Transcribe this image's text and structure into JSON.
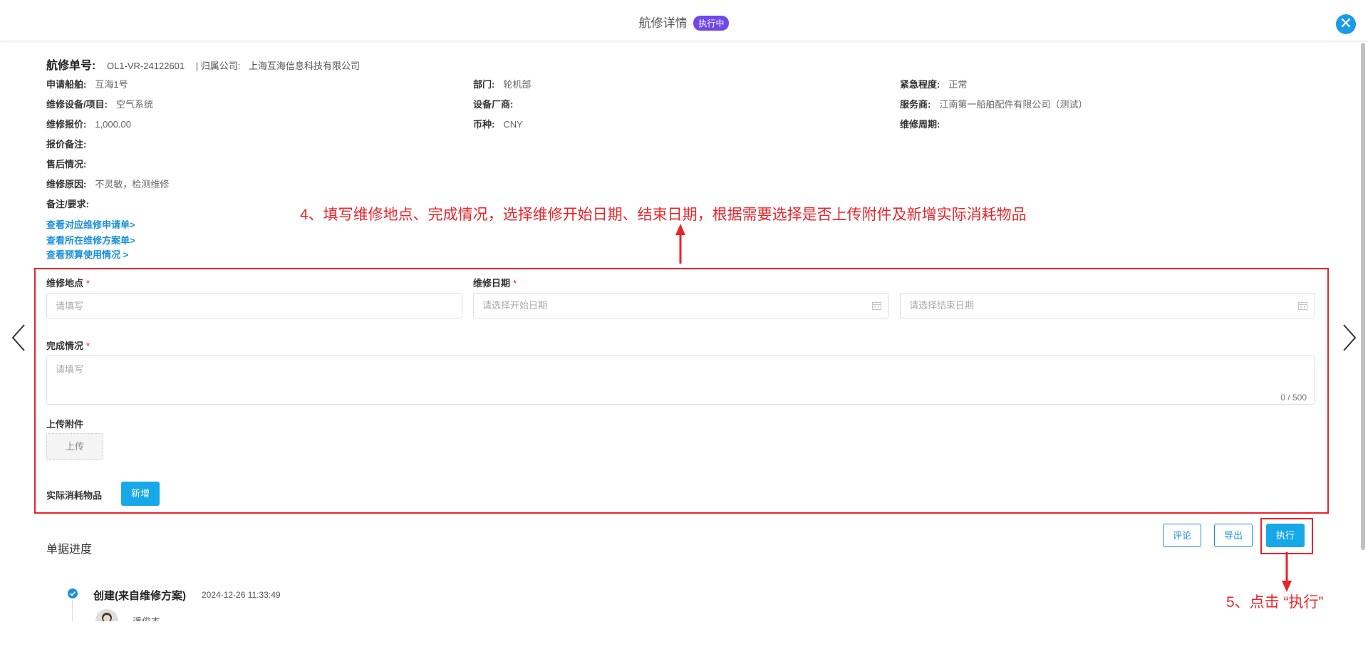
{
  "header": {
    "title": "航修详情",
    "status": "执行中"
  },
  "order": {
    "no_label": "航修单号:",
    "no_value": "OL1-VR-24122601",
    "company_label": "| 归属公司:",
    "company_value": "上海互海信息科技有限公司"
  },
  "info": {
    "ship_label": "申请船舶:",
    "ship_value": "互海1号",
    "dept_label": "部门:",
    "dept_value": "轮机部",
    "urgency_label": "紧急程度:",
    "urgency_value": "正常",
    "equipment_label": "维修设备/项目:",
    "equipment_value": "空气系统",
    "vendor_label": "设备厂商:",
    "vendor_value": "",
    "provider_label": "服务商:",
    "provider_value": "江南第一船舶配件有限公司（测试）",
    "quote_label": "维修报价:",
    "quote_value": "1,000.00",
    "currency_label": "币种:",
    "currency_value": "CNY",
    "cycle_label": "维修周期:",
    "cycle_value": "",
    "quote_note_label": "报价备注:",
    "quote_note_value": "",
    "aftersale_label": "售后情况:",
    "aftersale_value": "",
    "reason_label": "维修原因:",
    "reason_value": "不灵敏，检测维修",
    "remark_label": "备注/要求:",
    "remark_value": ""
  },
  "links": {
    "request": "查看对应维修申请单>",
    "plan": "查看所在维修方案单>",
    "budget": "查看预算使用情况 >"
  },
  "annotations": {
    "step4": "4、填写维修地点、完成情况，选择维修开始日期、结束日期，根据需要选择是否上传附件及新增实际消耗物品",
    "step5": "5、点击 “执行”"
  },
  "form": {
    "location_label": "维修地点",
    "location_placeholder": "请填写",
    "date_label": "维修日期",
    "start_placeholder": "请选择开始日期",
    "end_placeholder": "请选择结束日期",
    "completion_label": "完成情况",
    "completion_placeholder": "请填写",
    "completion_counter": "0 / 500",
    "attachment_label": "上传附件",
    "upload_label": "上传",
    "consumables_label": "实际消耗物品",
    "add_label": "新增",
    "required_mark": "*"
  },
  "actions": {
    "comment": "评论",
    "export": "导出",
    "execute": "执行"
  },
  "progress": {
    "title": "单据进度",
    "entry_title": "创建(来自维修方案)",
    "entry_time": "2024-12-26 11:33:49",
    "entry_user": "潘俊杰"
  },
  "colors": {
    "accent": "#17a8e8",
    "status_badge": "#7048e8",
    "annotation_red": "#e8242a"
  }
}
